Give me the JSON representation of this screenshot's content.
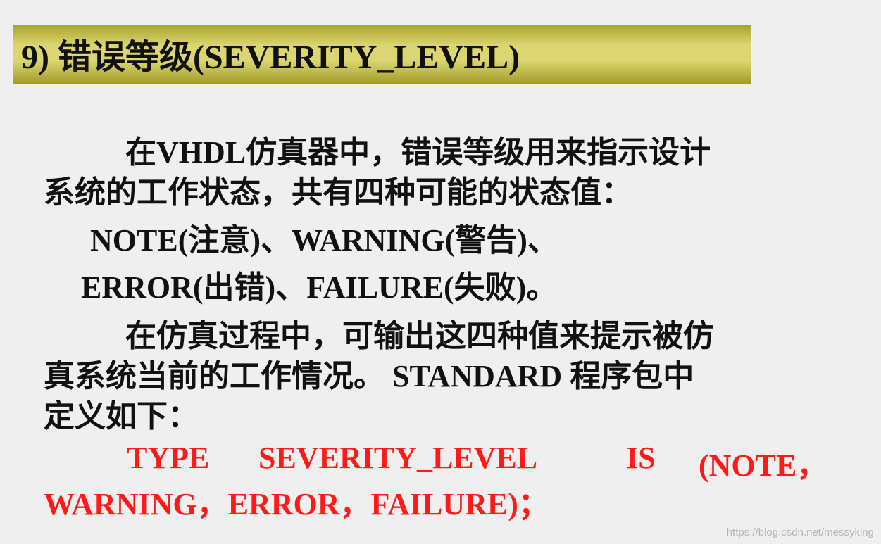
{
  "title": "9) 错误等级(SEVERITY_LEVEL)",
  "paragraph1": {
    "line1": "在VHDL仿真器中，错误等级用来指示设计",
    "line2": "系统的工作状态，共有四种可能的状态值："
  },
  "levels": {
    "line1": "NOTE(注意)、WARNING(警告)、",
    "line2": "ERROR(出错)、FAILURE(失败)。"
  },
  "paragraph2": {
    "line1": "在仿真过程中，可输出这四种值来提示被仿",
    "line2": "真系统当前的工作情况。 STANDARD 程序包中",
    "line3": "定义如下："
  },
  "code": {
    "tokens": [
      "TYPE",
      "SEVERITY_LEVEL",
      "IS",
      "(NOTE，"
    ],
    "line2": "WARNING，ERROR，FAILURE)；"
  },
  "watermark": "https://blog.csdn.net/messyking",
  "colors": {
    "background": "#efefef",
    "title_bar": "#dcd672",
    "code": "#ff1a1a",
    "text": "#111111"
  }
}
